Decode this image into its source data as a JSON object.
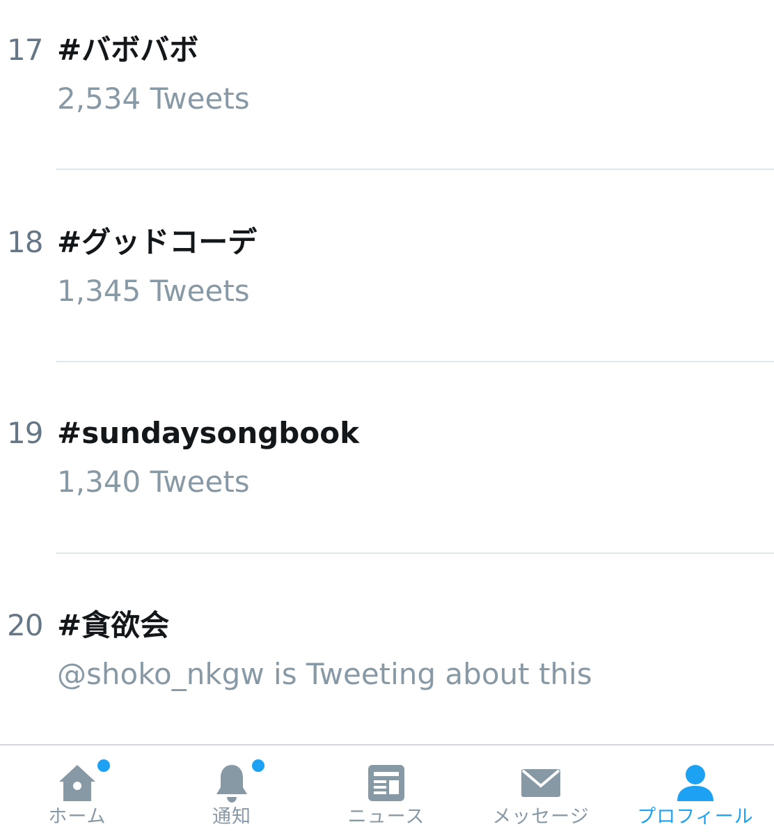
{
  "trends": [
    {
      "rank": "17",
      "name": "#バボバボ",
      "meta": "2,534 Tweets"
    },
    {
      "rank": "18",
      "name": "#グッドコーデ",
      "meta": "1,345 Tweets"
    },
    {
      "rank": "19",
      "name": "#sundaysongbook",
      "meta": "1,340 Tweets"
    },
    {
      "rank": "20",
      "name": "#貪欲会",
      "meta": "@shoko_nkgw is Tweeting about this"
    }
  ],
  "tabbar": {
    "home_label": "ホーム",
    "notifications_label": "通知",
    "news_label": "ニュース",
    "messages_label": "メッセージ",
    "profile_label": "プロフィール",
    "active_tab": "profile"
  },
  "colors": {
    "accent": "#1da1f2",
    "inactive_icon": "#8899a6",
    "primary_text": "#14171a",
    "secondary_text": "#8899a6",
    "divider": "#e1e8ed"
  },
  "icons": {
    "home": "home-icon",
    "notifications": "bell-icon",
    "news": "news-icon",
    "messages": "envelope-icon",
    "profile": "person-icon"
  }
}
